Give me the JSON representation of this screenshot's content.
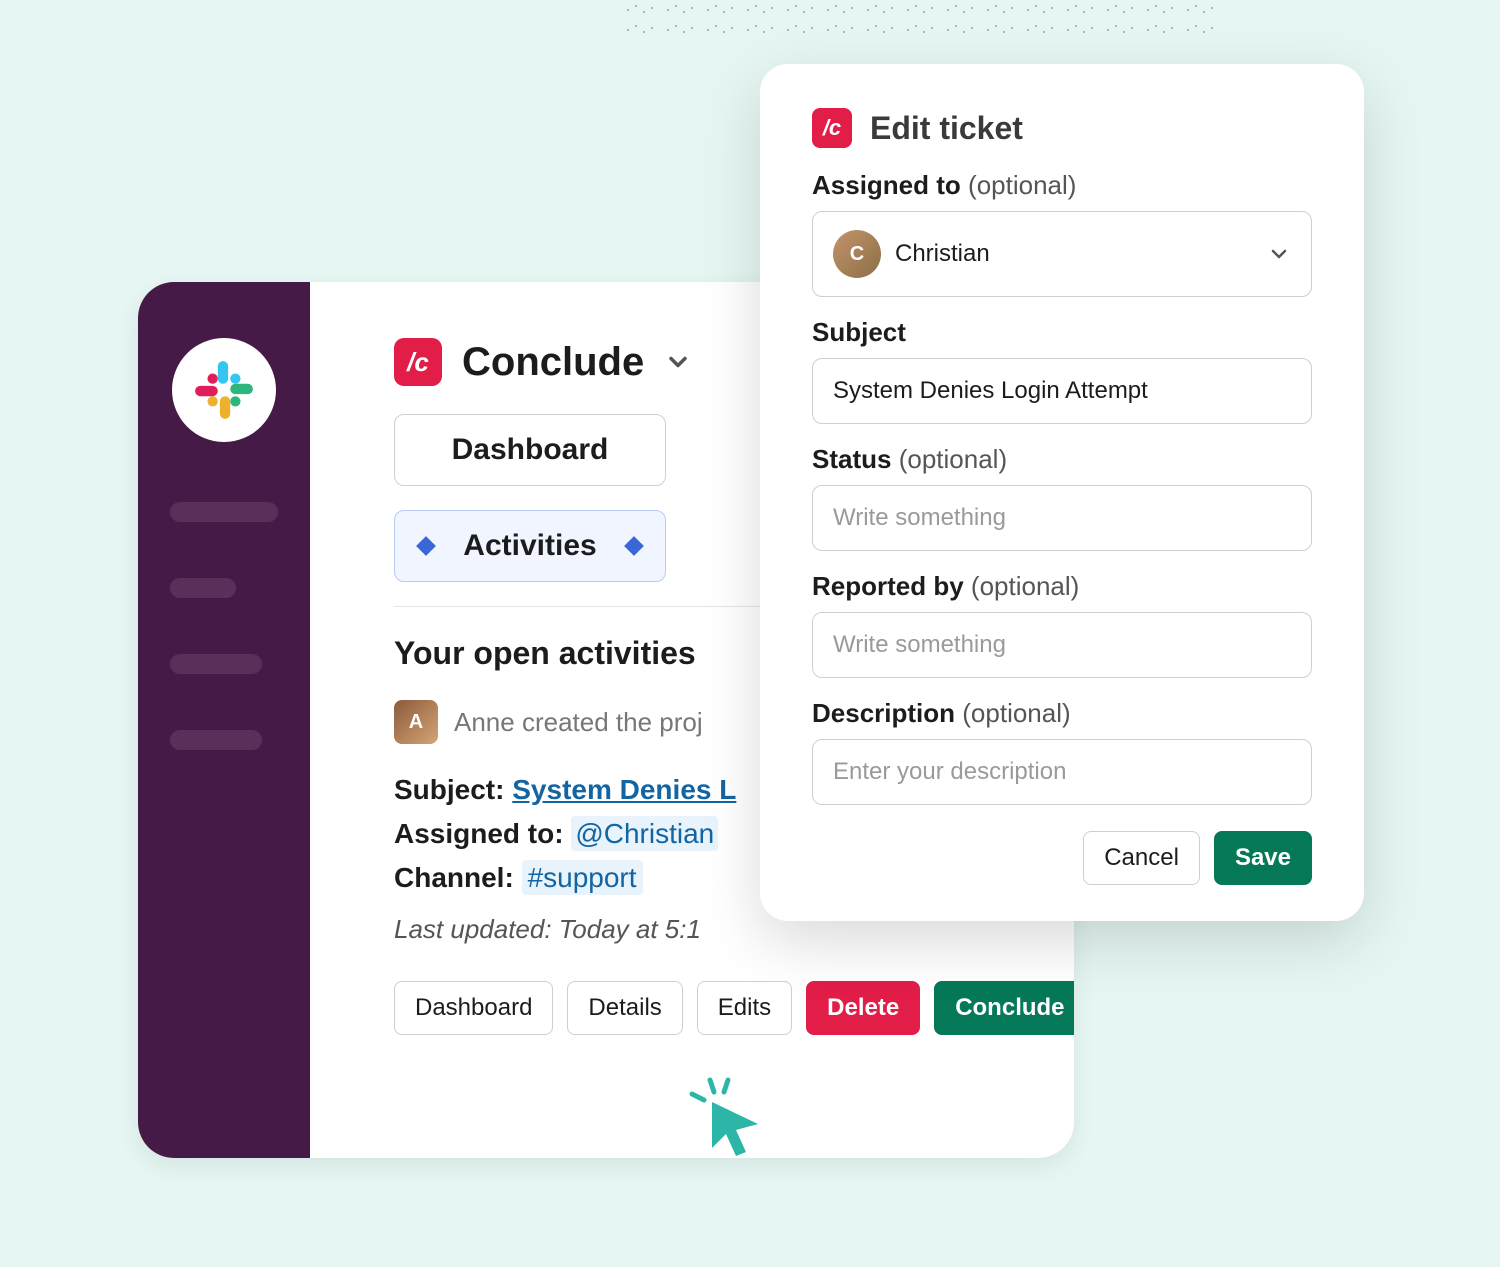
{
  "app": {
    "name": "Conclude",
    "icon_glyph": "/c"
  },
  "nav": {
    "dashboard": "Dashboard",
    "activities": "Activities"
  },
  "sidebar_chip_glyph": "/c",
  "section": {
    "title": "Your open activities",
    "created_by_text": "Anne created the proj",
    "creator_initial": "A"
  },
  "ticket": {
    "subject_label": "Subject:",
    "subject_link": "System Denies L",
    "assigned_label": "Assigned to:",
    "assigned_value": "@Christian",
    "channel_label": "Channel:",
    "channel_value": "#support",
    "updated": "Last updated: Today at 5:1"
  },
  "actions": {
    "dashboard": "Dashboard",
    "details": "Details",
    "edits": "Edits",
    "delete": "Delete",
    "conclude": "Conclude"
  },
  "modal": {
    "title": "Edit ticket",
    "icon_glyph": "/c",
    "assigned_label": "Assigned to",
    "optional": "(optional)",
    "assignee_value": "Christian",
    "assignee_initial": "C",
    "subject_label": "Subject",
    "subject_value": "System Denies Login Attempt",
    "status_label": "Status",
    "status_placeholder": "Write something",
    "reported_label": "Reported by",
    "reported_placeholder": "Write something",
    "description_label": "Description",
    "description_placeholder": "Enter your description",
    "cancel": "Cancel",
    "save": "Save"
  },
  "colors": {
    "brand_red": "#e11d48",
    "brand_green": "#047857",
    "slack_purple": "#461a47"
  }
}
